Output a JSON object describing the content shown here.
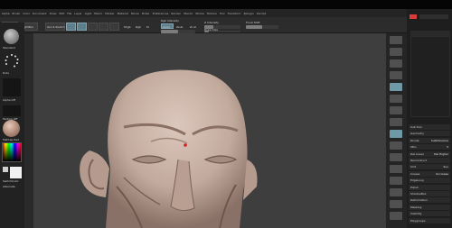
{
  "menubar": {
    "items": [
      "Alpha",
      "Brush",
      "Color",
      "Document",
      "Draw",
      "Edit",
      "File",
      "Layer",
      "Light",
      "Macro",
      "Marker",
      "Material",
      "Movie",
      "Picker",
      "Preferences",
      "Render",
      "Stencil",
      "Stroke",
      "Texture",
      "Tool",
      "Transform",
      "Zplugin",
      "Zscript"
    ]
  },
  "toolbar": {
    "projection_label": "Projection Master",
    "lightbox_label": "LightBox",
    "quick_label": "Quick Sketch",
    "edit_label": "Edit",
    "draw_label": "Draw",
    "move_label": "Move",
    "scale_label": "Scale",
    "rotate_label": "Rotate",
    "mrgb_label": "Mrgb",
    "rgb_label": "Rgb",
    "m_label": "M",
    "zadd_label": "Zadd",
    "zsub_label": "Zsub",
    "zcut_label": "Zcut",
    "rgb_intensity_label": "Rgb Intensity",
    "z_intensity_label": "Z Intensity",
    "draw_size_label": "Draw Size",
    "focal_shift_label": "Focal Shift",
    "z_intensity_value": 0.25,
    "draw_size_value": 0.12,
    "focal_shift_value": 0.5,
    "rgb_intensity_value": 0.5
  },
  "left_shelf": {
    "brush_label": "Standard",
    "stroke_label": "Dots",
    "alpha_label": "Alpha Off",
    "texture_label": "Texture Off",
    "material_label": "MatCap Red",
    "gradient_label": "Gradient",
    "switch_color_label": "SwitchColor",
    "alternate_label": "Alternate"
  },
  "right_panel": {
    "rows": [
      {
        "label": "Sub Tool",
        "value": ""
      },
      {
        "label": "Geometry",
        "value": ""
      },
      {
        "label": "Divide",
        "value": "SubDivisions"
      },
      {
        "label": "SDiv",
        "value": "5"
      },
      {
        "label": "Del Lower",
        "value": "Del Higher"
      },
      {
        "label": "Reconstruct",
        "value": ""
      },
      {
        "label": "Smt",
        "value": "Suv"
      },
      {
        "label": "Crease",
        "value": "Uncrease"
      },
      {
        "label": "EdgeLoop",
        "value": ""
      },
      {
        "label": "Polish",
        "value": ""
      },
      {
        "label": "ShadowBox",
        "value": ""
      },
      {
        "label": "Deformation",
        "value": ""
      },
      {
        "label": "Masking",
        "value": ""
      },
      {
        "label": "Visibility",
        "value": ""
      },
      {
        "label": "Polygroups",
        "value": ""
      }
    ],
    "accent_color": "#d93a3a"
  },
  "icons": {
    "right_shelf": [
      "bpr-icon",
      "scroll-icon",
      "zoom-icon",
      "actual-icon",
      "aahalf-icon",
      "persp-icon",
      "floor-icon",
      "local-icon",
      "xyz-icon",
      "frame-icon",
      "move-icon",
      "scale-icon",
      "rotate-icon",
      "polyf-icon",
      "transp-icon",
      "solo-icon"
    ]
  },
  "colors": {
    "viewport_bg": "#3e3e3e",
    "skin": "#c9b2a6",
    "accent": "#6e9aa8",
    "marker": "#d32020"
  }
}
